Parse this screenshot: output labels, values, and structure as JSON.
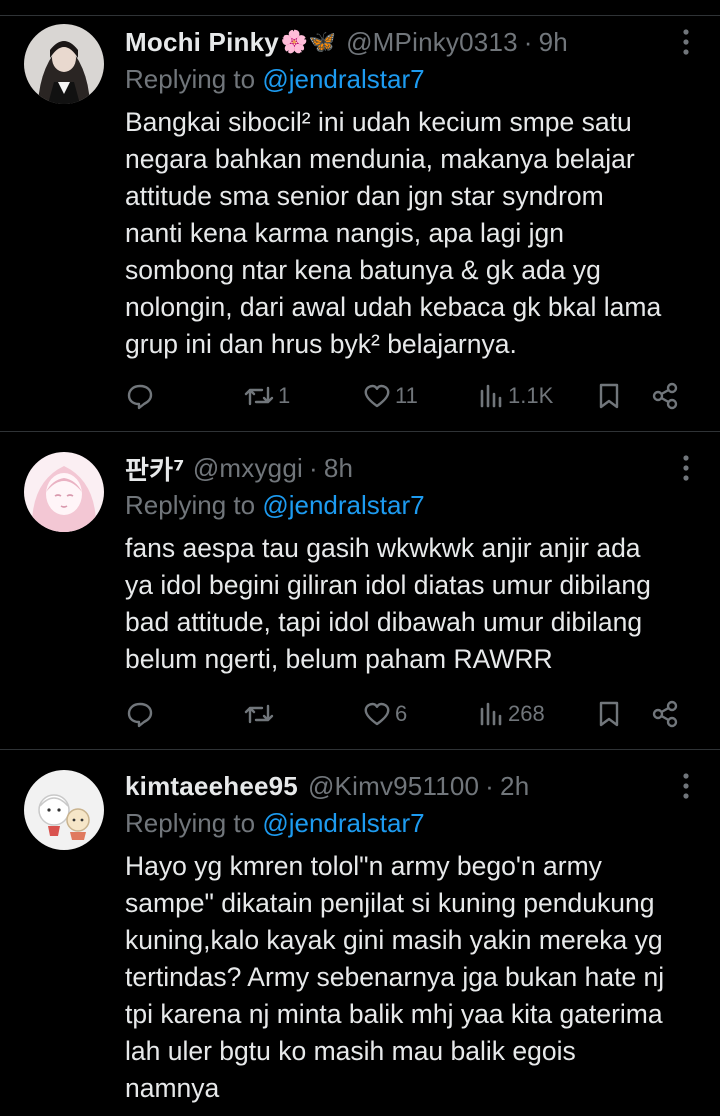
{
  "replies": [
    {
      "display_name": "Mochi Pinky",
      "emoji": "🌸🦋",
      "handle": "@MPinky0313",
      "separator": "·",
      "time": "9h",
      "replying_prefix": "Replying to ",
      "replying_to": "@jendralstar7",
      "text_lines": [
        "Bangkai sibocil² ini udah kecium smpe satu",
        "negara bahkan mendunia, makanya belajar",
        "attitude sma senior dan jgn star syndrom",
        "nanti kena karma nangis, apa lagi jgn",
        "sombong ntar kena batunya & gk ada yg",
        "nolongin, dari awal udah kebaca gk bkal lama",
        "grup ini dan hrus byk² belajarnya."
      ],
      "stats": {
        "retweets": "1",
        "likes": "11",
        "views": "1.1K"
      }
    },
    {
      "display_name": "판카⁷",
      "emoji": "",
      "handle": "@mxyggi",
      "separator": "·",
      "time": "8h",
      "replying_prefix": "Replying to ",
      "replying_to": "@jendralstar7",
      "text_lines": [
        "fans aespa tau gasih wkwkwk anjir anjir ada",
        "ya idol begini giliran idol diatas umur dibilang",
        "bad attitude, tapi idol dibawah umur dibilang",
        "belum ngerti, belum paham RAWRR"
      ],
      "stats": {
        "retweets": "",
        "likes": "6",
        "views": "268"
      }
    },
    {
      "display_name": "kimtaeehee95",
      "emoji": "",
      "handle": "@Kimv951100",
      "separator": "·",
      "time": "2h",
      "replying_prefix": "Replying to ",
      "replying_to": "@jendralstar7",
      "text_lines": [
        "Hayo yg kmren tolol\"n army bego'n army",
        "sampe\" dikatain penjilat si kuning pendukung",
        "kuning,kalo kayak gini masih yakin mereka yg",
        "tertindas? Army sebenarnya jga bukan hate nj",
        "tpi karena nj minta balik mhj yaa kita gaterima",
        "lah uler bgtu ko masih mau balik egois",
        "namnya"
      ],
      "stats": {}
    }
  ],
  "icons": {
    "reply": "reply-bubble-icon",
    "retweet": "retweet-icon",
    "like": "heart-icon",
    "views": "views-chart-icon",
    "bookmark": "bookmark-icon",
    "share": "share-icon",
    "more": "more-vertical-icon"
  },
  "colors": {
    "background": "#000000",
    "text": "#e7e9ea",
    "muted": "#71767b",
    "link": "#1d9bf0",
    "divider": "#2f3336"
  }
}
